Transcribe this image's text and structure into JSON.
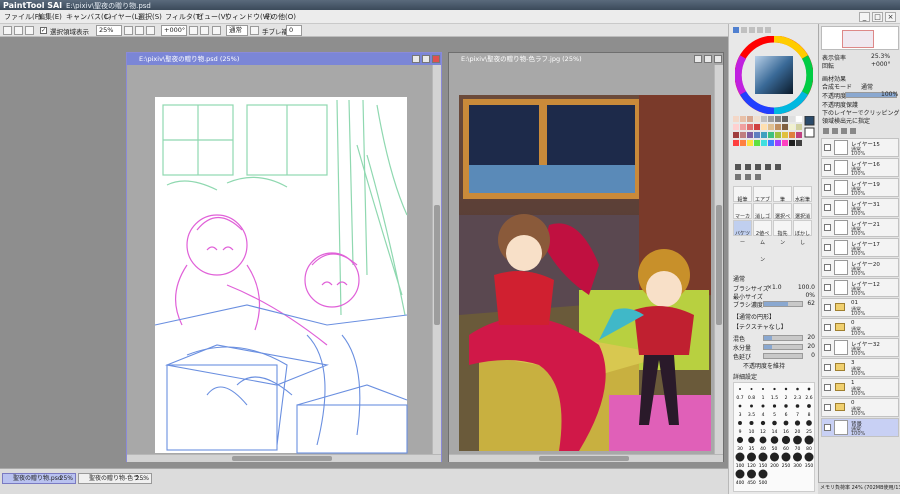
{
  "window": {
    "app_name": "PaintTool SAI",
    "title": "E:\\pixiv\\聖夜の贈り物.psd"
  },
  "menu": [
    "ファイル(F)",
    "編集(E)",
    "キャンバス(C)",
    "レイヤー(L)",
    "選択(S)",
    "フィルタ(T)",
    "ビュー(V)",
    "ウィンドウ(W)",
    "その他(O)"
  ],
  "toolbar": {
    "selection_display_label": "選択領域表示",
    "zoom": "25%",
    "angle": "+000°",
    "mode": "通常",
    "stabilizer_label": "手ブレ補正",
    "stabilizer_value": "0"
  },
  "documents": [
    {
      "title": "E:\\pixiv\\聖夜の贈り物.psd (25%)",
      "active": true
    },
    {
      "title": "E:\\pixiv\\聖夜の贈り物-色ラフ.jpg (25%)",
      "active": false
    }
  ],
  "taskbar": [
    {
      "label": "聖夜の贈り物.psd",
      "zoom": "25%"
    },
    {
      "label": "聖夜の贈り物-色ラ...",
      "zoom": "25%"
    }
  ],
  "color_panel": {
    "blend_label": "通常",
    "brush_size_label": "ブラシサイズ",
    "brush_size_mult": "×1.0",
    "brush_size_value": "100.0",
    "min_size_label": "最小サイズ",
    "min_size_value": "0%",
    "density_label": "ブラシ濃度",
    "density_value": "62",
    "edge_label": "【通常の円形】",
    "texture_label": "【テクスチャなし】",
    "blend2_label": "混色",
    "blend2_value": "20",
    "water_label": "水分量",
    "water_value": "20",
    "stretch_label": "色延び",
    "stretch_value": "0",
    "keep_opacity_label": "不透明度を維持",
    "detail_label": "詳細設定",
    "brush_sizes": [
      "0.7",
      "0.8",
      "1",
      "1.5",
      "2",
      "2.3",
      "2.6",
      "3",
      "3.5",
      "4",
      "5",
      "6",
      "7",
      "8",
      "9",
      "10",
      "12",
      "14",
      "16",
      "20",
      "25",
      "30",
      "35",
      "40",
      "50",
      "60",
      "70",
      "80",
      "100",
      "120",
      "150",
      "200",
      "250",
      "300",
      "350",
      "400",
      "450",
      "500"
    ],
    "tool_labels": [
      "鉛筆",
      "エアブラシ",
      "筆",
      "水彩筆",
      "マーカー",
      "消しゴム",
      "選択ペン",
      "選択消し",
      "バケツ",
      "2値ペン",
      "指先",
      "ぼかし"
    ]
  },
  "navigator": {
    "zoom_label": "表示倍率",
    "zoom_value": "25.3%",
    "angle_label": "回転",
    "angle_value": "+000°"
  },
  "layer_panel": {
    "effects_label": "画材効果",
    "blend_mode_label": "合成モード",
    "blend_mode_value": "通常",
    "opacity_label": "不透明度",
    "opacity_value": "100%",
    "protect_opacity": "不透明度保護",
    "clip_lower": "下のレイヤーでクリッピング",
    "selection_source": "領域検出元に指定",
    "layers": [
      {
        "name": "レイヤー15",
        "mode": "通常",
        "opacity": "100%",
        "type": "layer"
      },
      {
        "name": "レイヤー16",
        "mode": "通常",
        "opacity": "100%",
        "type": "layer"
      },
      {
        "name": "レイヤー19",
        "mode": "通常",
        "opacity": "100%",
        "type": "layer"
      },
      {
        "name": "レイヤー31",
        "mode": "通常",
        "opacity": "100%",
        "type": "layer"
      },
      {
        "name": "レイヤー21",
        "mode": "通常",
        "opacity": "100%",
        "type": "layer"
      },
      {
        "name": "レイヤー17",
        "mode": "通常",
        "opacity": "100%",
        "type": "layer"
      },
      {
        "name": "レイヤー20",
        "mode": "通常",
        "opacity": "100%",
        "type": "layer"
      },
      {
        "name": "レイヤー12",
        "mode": "通常",
        "opacity": "100%",
        "type": "layer"
      },
      {
        "name": "01",
        "mode": "通常",
        "opacity": "100%",
        "type": "folder"
      },
      {
        "name": "0",
        "mode": "通常",
        "opacity": "100%",
        "type": "folder"
      },
      {
        "name": "レイヤー32",
        "mode": "通常",
        "opacity": "100%",
        "type": "layer"
      },
      {
        "name": "3",
        "mode": "通常",
        "opacity": "100%",
        "type": "folder"
      },
      {
        "name": "1",
        "mode": "通常",
        "opacity": "100%",
        "type": "folder"
      },
      {
        "name": "0",
        "mode": "通常",
        "opacity": "100%",
        "type": "folder"
      },
      {
        "name": "背景",
        "mode": "通常",
        "opacity": "100%",
        "type": "layer"
      }
    ]
  },
  "status": {
    "memory": "メモリ負荷率 24% (702MB使用/1349MB確保)"
  },
  "colors": {
    "accent": "#8080d8",
    "active_title": "#7b86d6",
    "inactive_title": "#a8a8a8"
  }
}
